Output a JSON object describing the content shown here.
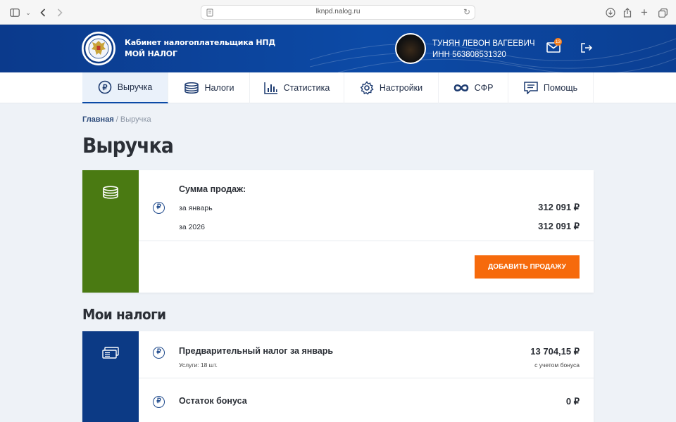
{
  "browser": {
    "url": "lknpd.nalog.ru"
  },
  "header": {
    "brand_line1": "Кабинет налогоплательщика НПД",
    "brand_line2": "МОЙ НАЛОГ",
    "user_name": "ТУНЯН ЛЕВОН ВАГЕЕВИЧ",
    "user_inn": "ИНН 563808531320",
    "mail_badge": "13"
  },
  "nav": {
    "items": [
      {
        "label": "Выручка",
        "icon": "ruble-circle-icon",
        "active": true
      },
      {
        "label": "Налоги",
        "icon": "coins-stack-icon"
      },
      {
        "label": "Статистика",
        "icon": "bar-chart-icon"
      },
      {
        "label": "Настройки",
        "icon": "gear-icon"
      },
      {
        "label": "СФР",
        "icon": "sfr-logo-icon"
      },
      {
        "label": "Помощь",
        "icon": "help-doc-icon"
      }
    ]
  },
  "breadcrumb": {
    "home": "Главная",
    "separator": " / ",
    "current": "Выручка"
  },
  "page_title": "Выручка",
  "sales_card": {
    "title": "Сумма продаж:",
    "month_label": "за январь",
    "month_value": "312 091 ₽",
    "year_label": "за 2026",
    "year_value": "312 091 ₽",
    "add_button": "ДОБАВИТЬ ПРОДАЖУ",
    "accent_color": "#4a7a12"
  },
  "taxes_section": {
    "title": "Мои налоги",
    "accent_color": "#0c3a85",
    "prelim_title": "Предварительный налог за январь",
    "prelim_sub": "Услуги: 18 шт.",
    "prelim_value": "13 704,15 ₽",
    "prelim_note": "с учетом бонуса",
    "bonus_title": "Остаток бонуса",
    "bonus_value": "0 ₽"
  },
  "colors": {
    "header_blue": "#0c4aa6",
    "button_orange": "#f66a0c",
    "badge_orange": "#f27c1c"
  }
}
